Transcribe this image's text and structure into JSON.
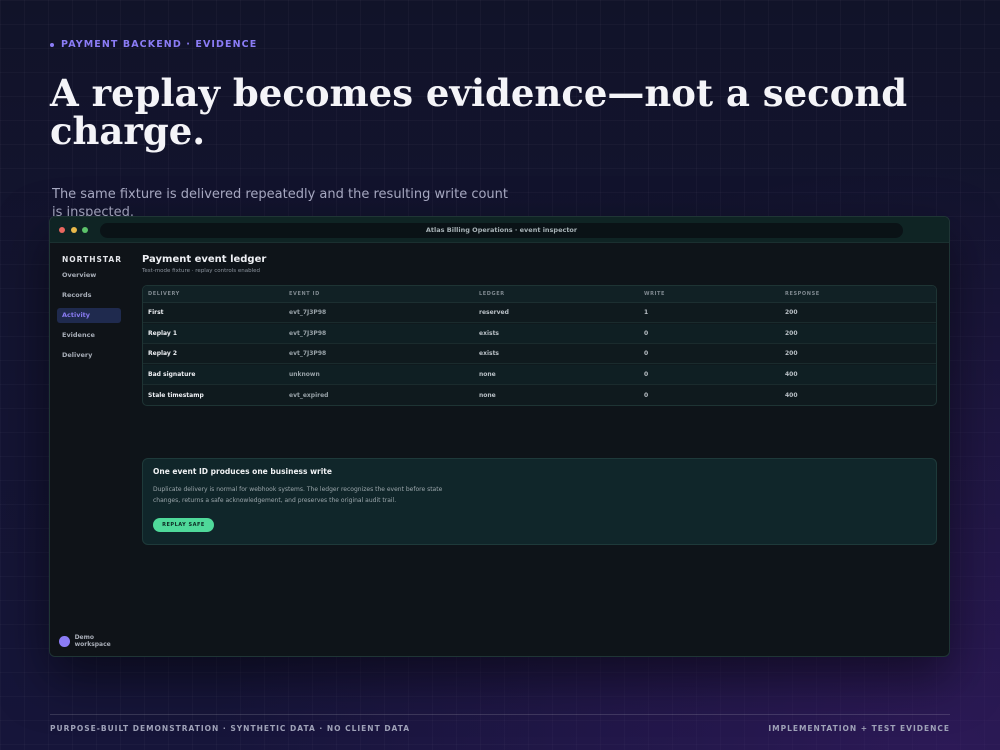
{
  "slide": {
    "eyebrow": "PAYMENT BACKEND · EVIDENCE",
    "headline": "A replay becomes evidence—not a second charge.",
    "lede": "The same fixture is delivered repeatedly and the resulting write count is inspected.",
    "footer_left": "PURPOSE-BUILT DEMONSTRATION · SYNTHETIC DATA · NO CLIENT DATA",
    "footer_right": "IMPLEMENTATION + TEST EVIDENCE",
    "accent_color": "#8b7cf6"
  },
  "window": {
    "title": "Atlas Billing Operations · event inspector",
    "traffic_lights": [
      "#e9675f",
      "#e8b84a",
      "#5cc26a"
    ]
  },
  "sidebar": {
    "brand": "NORTHSTAR",
    "items": [
      {
        "label": "Overview",
        "active": false
      },
      {
        "label": "Records",
        "active": false
      },
      {
        "label": "Activity",
        "active": true
      },
      {
        "label": "Evidence",
        "active": false
      },
      {
        "label": "Delivery",
        "active": false
      }
    ],
    "workspace": "Demo workspace"
  },
  "main": {
    "title": "Payment event ledger",
    "subtitle": "Test-mode fixture · replay controls enabled",
    "table": {
      "headers": [
        "DELIVERY",
        "EVENT ID",
        "LEDGER",
        "WRITE",
        "RESPONSE"
      ],
      "rows": [
        [
          "First",
          "evt_7J3P98",
          "reserved",
          "1",
          "200"
        ],
        [
          "Replay 1",
          "evt_7J3P98",
          "exists",
          "0",
          "200"
        ],
        [
          "Replay 2",
          "evt_7J3P98",
          "exists",
          "0",
          "200"
        ],
        [
          "Bad signature",
          "unknown",
          "none",
          "0",
          "400"
        ],
        [
          "Stale timestamp",
          "evt_expired",
          "none",
          "0",
          "400"
        ]
      ]
    },
    "callout": {
      "title": "One event ID produces one business write",
      "body": "Duplicate delivery is normal for webhook systems. The ledger recognizes the event before state changes, returns a safe acknowledgement, and preserves the original audit trail.",
      "badge": "REPLAY SAFE",
      "badge_color": "#4fd99a"
    }
  }
}
